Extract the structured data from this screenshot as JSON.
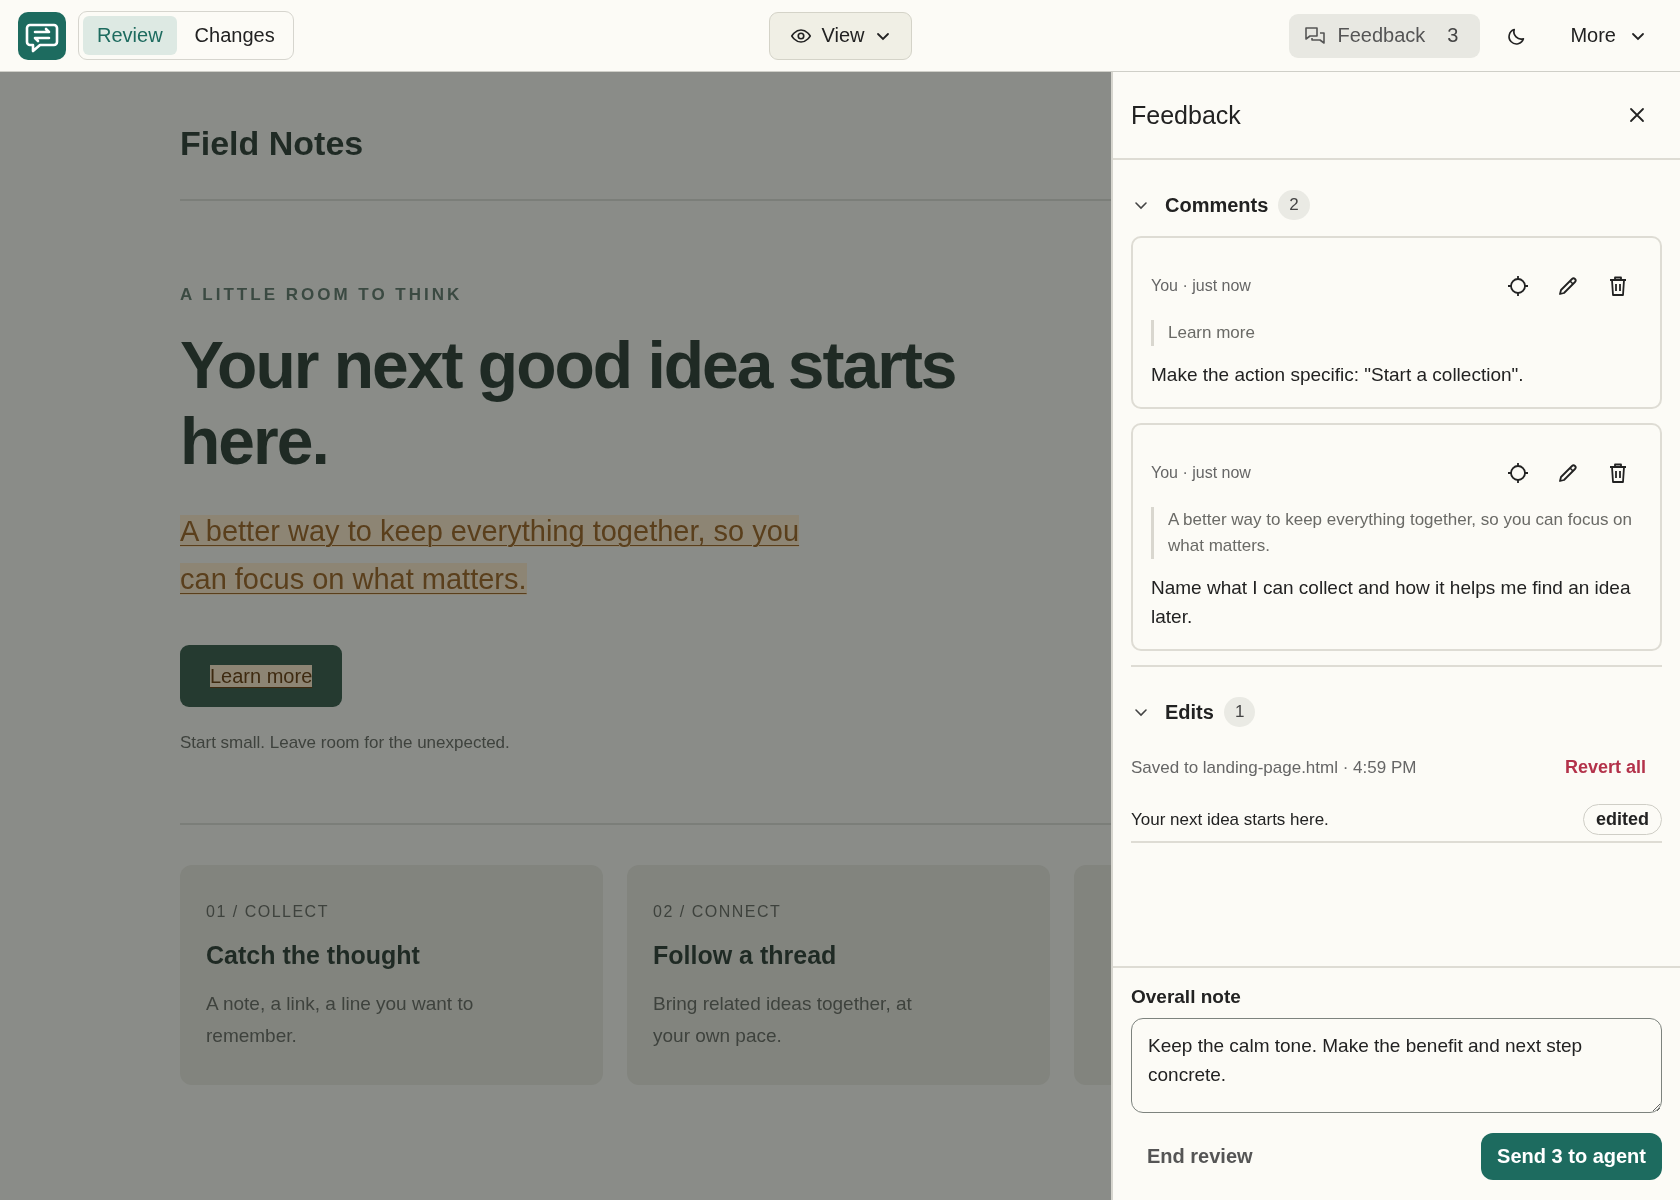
{
  "toolbar": {
    "tabs": [
      {
        "label": "Review",
        "selected": true
      },
      {
        "label": "Changes",
        "selected": false
      }
    ],
    "view_button": "View",
    "feedback_button": {
      "label": "Feedback",
      "count": "3",
      "selected": true
    },
    "more_button": "More"
  },
  "page": {
    "title": "Field Notes",
    "eyebrow": "A LITTLE ROOM TO THINK",
    "headline": "Your next good idea starts here.",
    "subhead": {
      "text": "A better way to keep everything together, so you can focus on what matters.",
      "highlighted": true
    },
    "cta": {
      "label": "Learn more",
      "highlighted": true
    },
    "note": "Start small. Leave room for the unexpected.",
    "cards": [
      {
        "label": "01 / COLLECT",
        "title": "Catch the thought",
        "text": "A note, a link, a line you want to remember."
      },
      {
        "label": "02 / CONNECT",
        "title": "Follow a thread",
        "text": "Bring related ideas together, at your own pace."
      }
    ]
  },
  "panel": {
    "title": "Feedback",
    "comments": {
      "label": "Comments",
      "count": "2",
      "expanded": true,
      "items": [
        {
          "meta": "You · just now",
          "quote": "Learn more",
          "text": "Make the action specific: \"Start a collection\"."
        },
        {
          "meta": "You · just now",
          "quote": "A better way to keep everything together, so you can focus on what matters.",
          "text": "Name what I can collect and how it helps me find an idea later."
        }
      ]
    },
    "edits": {
      "label": "Edits",
      "count": "1",
      "expanded": true,
      "saved": "Saved to landing-page.html · 4:59 PM",
      "revert": "Revert all",
      "items": [
        {
          "text": "Your next idea starts here.",
          "badge": "edited"
        }
      ]
    },
    "overall_note": {
      "label": "Overall note",
      "value": "Keep the calm tone. Make the benefit and next step concrete."
    },
    "end_button": "End review",
    "send_button": "Send 3 to agent"
  }
}
